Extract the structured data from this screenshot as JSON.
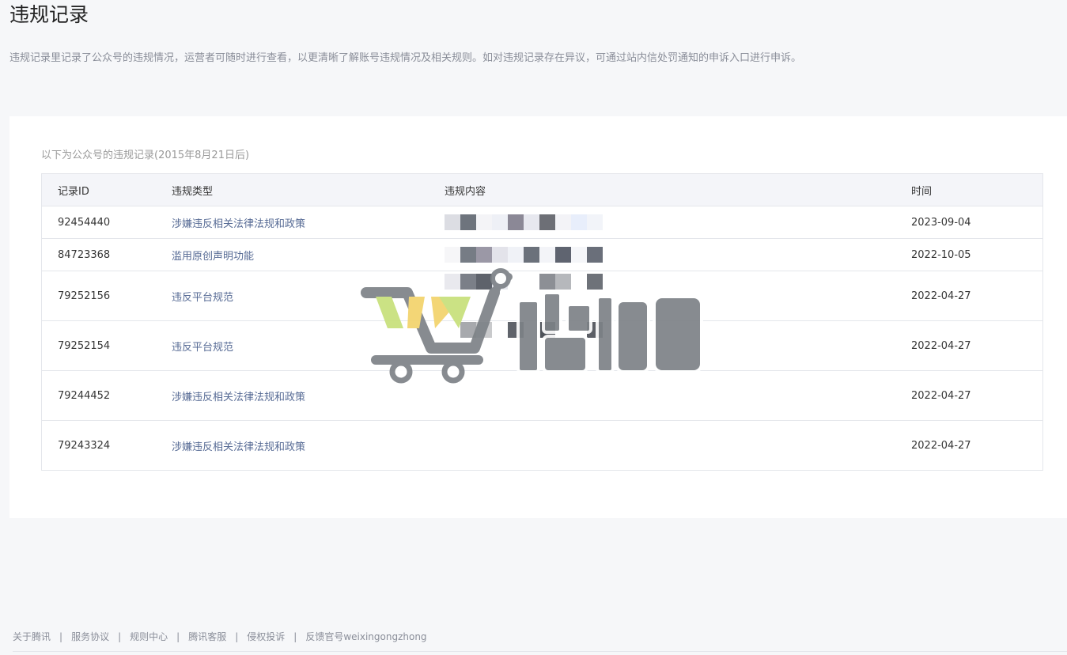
{
  "page": {
    "title": "违规记录",
    "description": "违规记录里记录了公众号的违规情况，运营者可随时进行查看，以更清晰了解账号违规情况及相关规则。如对违规记录存在异议，可通过站内信处罚通知的申诉入口进行申诉。"
  },
  "records": {
    "caption": "以下为公众号的违规记录(2015年8月21日后)",
    "headers": {
      "id": "记录ID",
      "type": "违规类型",
      "content": "违规内容",
      "time": "时间"
    },
    "rows": [
      {
        "id": "92454440",
        "type": "涉嫌违反相关法律法规和政策",
        "time": "2023-09-04"
      },
      {
        "id": "84723368",
        "type": "滥用原创声明功能",
        "time": "2022-10-05"
      },
      {
        "id": "79252156",
        "type": "违反平台规范",
        "time": "2022-04-27"
      },
      {
        "id": "79252154",
        "type": "违反平台规范",
        "time": "2022-04-27"
      },
      {
        "id": "79244452",
        "type": "涉嫌违反相关法律法规和政策",
        "time": "2022-04-27"
      },
      {
        "id": "79243324",
        "type": "涉嫌违反相关法律法规和政策",
        "time": "2022-04-27"
      }
    ]
  },
  "footer": {
    "links": [
      "关于腾讯",
      "服务协议",
      "规则中心",
      "腾讯客服",
      "侵权投诉",
      "反馈官号weixingongzhong"
    ],
    "separator": "|"
  },
  "colors": {
    "link": "#576b95",
    "background": "#f6f7f9",
    "watermark_gray": "#7d8287",
    "watermark_yellow": "#f3d36b",
    "watermark_green": "#c7e07a"
  },
  "icons": {
    "watermark": "shopping-cart-logo"
  }
}
